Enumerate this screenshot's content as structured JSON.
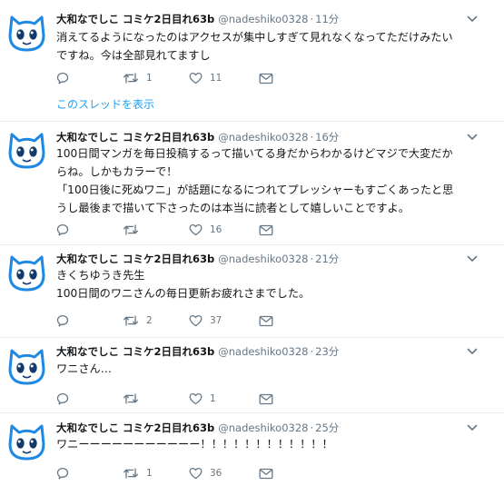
{
  "author": {
    "name": "大和なでしこ コミケ2日目れ63b",
    "handle": "@nadeshiko0328",
    "separator": "·"
  },
  "thread_link_label": "このスレッドを表示",
  "tweets": [
    {
      "time": "11分",
      "lines": [
        "消えてるようになったのはアクセスが集中しすぎて見れなくなってただけみたい",
        "ですね。今は全部見れてますし"
      ],
      "reply_count": "",
      "retweet_count": "1",
      "like_count": "11"
    },
    {
      "time": "16分",
      "lines": [
        "100日間マンガを毎日投稿するって描いてる身だからわかるけどマジで大変だか",
        "らね。しかもカラーで！",
        "「100日後に死ぬワニ」が話題になるにつれてプレッシャーもすごくあったと思",
        "うし最後まで描いて下さったのは本当に読者として嬉しいことですよ。"
      ],
      "reply_count": "",
      "retweet_count": "",
      "like_count": "16"
    },
    {
      "time": "21分",
      "lines": [
        "きくちゆうき先生",
        "100日間のワニさんの毎日更新お疲れさまでした。"
      ],
      "reply_count": "",
      "retweet_count": "2",
      "like_count": "37"
    },
    {
      "time": "23分",
      "lines": [
        "ワニさん…"
      ],
      "reply_count": "",
      "retweet_count": "",
      "like_count": "1"
    },
    {
      "time": "25分",
      "lines": [
        "ワニーーーーーーーーーーー！！！！！！！！！！！！"
      ],
      "reply_count": "",
      "retweet_count": "1",
      "like_count": "36"
    }
  ],
  "colors": {
    "icon_gray": "#657786",
    "link_blue": "#1da1f2",
    "avatar_blue": "#1e88e5",
    "avatar_navy": "#123a6b"
  }
}
